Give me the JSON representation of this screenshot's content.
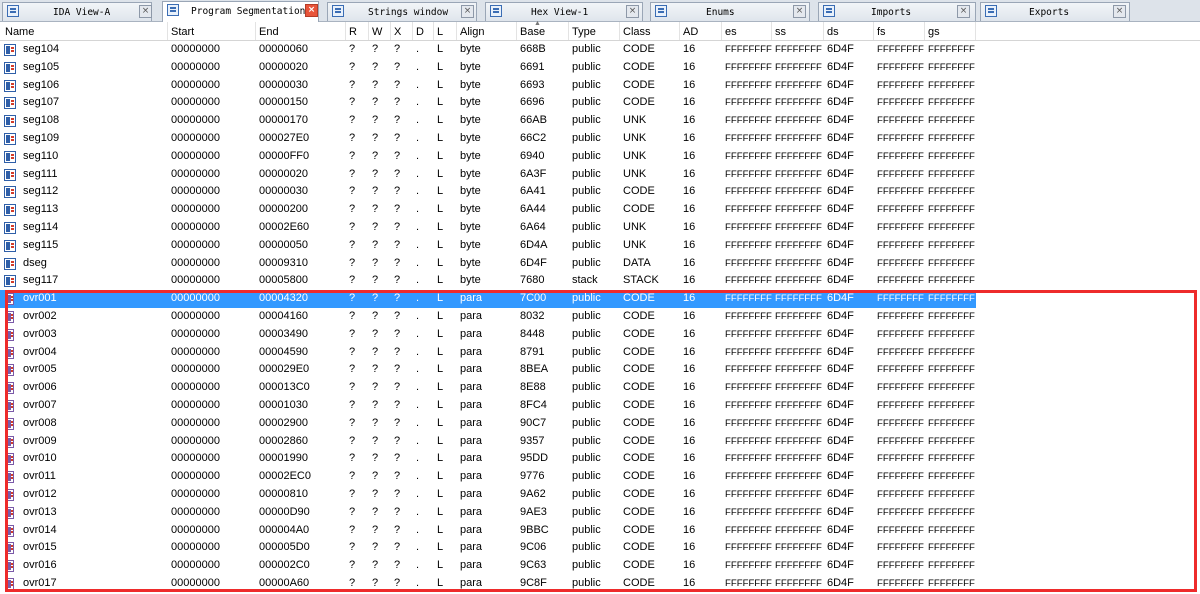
{
  "tabs": [
    {
      "label": "IDA View-A",
      "active": false,
      "icon": "disassembly-icon"
    },
    {
      "label": "Program Segmentation",
      "active": true,
      "icon": "segments-icon"
    },
    {
      "label": "Strings window",
      "active": false,
      "icon": "strings-icon"
    },
    {
      "label": "Hex View-1",
      "active": false,
      "icon": "hex-icon"
    },
    {
      "label": "Enums",
      "active": false,
      "icon": "enums-icon"
    },
    {
      "label": "Imports",
      "active": false,
      "icon": "imports-icon"
    },
    {
      "label": "Exports",
      "active": false,
      "icon": "exports-icon"
    }
  ],
  "columns": [
    "Name",
    "Start",
    "End",
    "R",
    "W",
    "X",
    "D",
    "L",
    "Align",
    "Base",
    "Type",
    "Class",
    "AD",
    "es",
    "ss",
    "ds",
    "fs",
    "gs"
  ],
  "sorted_column": "Base",
  "rows": [
    [
      "seg104",
      "00000000",
      "00000060",
      "?",
      "?",
      "?",
      ".",
      "L",
      "byte",
      "668B",
      "public",
      "CODE",
      "16",
      "FFFFFFFF",
      "FFFFFFFF",
      "6D4F",
      "FFFFFFFF",
      "FFFFFFFF"
    ],
    [
      "seg105",
      "00000000",
      "00000020",
      "?",
      "?",
      "?",
      ".",
      "L",
      "byte",
      "6691",
      "public",
      "CODE",
      "16",
      "FFFFFFFF",
      "FFFFFFFF",
      "6D4F",
      "FFFFFFFF",
      "FFFFFFFF"
    ],
    [
      "seg106",
      "00000000",
      "00000030",
      "?",
      "?",
      "?",
      ".",
      "L",
      "byte",
      "6693",
      "public",
      "CODE",
      "16",
      "FFFFFFFF",
      "FFFFFFFF",
      "6D4F",
      "FFFFFFFF",
      "FFFFFFFF"
    ],
    [
      "seg107",
      "00000000",
      "00000150",
      "?",
      "?",
      "?",
      ".",
      "L",
      "byte",
      "6696",
      "public",
      "CODE",
      "16",
      "FFFFFFFF",
      "FFFFFFFF",
      "6D4F",
      "FFFFFFFF",
      "FFFFFFFF"
    ],
    [
      "seg108",
      "00000000",
      "00000170",
      "?",
      "?",
      "?",
      ".",
      "L",
      "byte",
      "66AB",
      "public",
      "UNK",
      "16",
      "FFFFFFFF",
      "FFFFFFFF",
      "6D4F",
      "FFFFFFFF",
      "FFFFFFFF"
    ],
    [
      "seg109",
      "00000000",
      "000027E0",
      "?",
      "?",
      "?",
      ".",
      "L",
      "byte",
      "66C2",
      "public",
      "UNK",
      "16",
      "FFFFFFFF",
      "FFFFFFFF",
      "6D4F",
      "FFFFFFFF",
      "FFFFFFFF"
    ],
    [
      "seg110",
      "00000000",
      "00000FF0",
      "?",
      "?",
      "?",
      ".",
      "L",
      "byte",
      "6940",
      "public",
      "UNK",
      "16",
      "FFFFFFFF",
      "FFFFFFFF",
      "6D4F",
      "FFFFFFFF",
      "FFFFFFFF"
    ],
    [
      "seg111",
      "00000000",
      "00000020",
      "?",
      "?",
      "?",
      ".",
      "L",
      "byte",
      "6A3F",
      "public",
      "UNK",
      "16",
      "FFFFFFFF",
      "FFFFFFFF",
      "6D4F",
      "FFFFFFFF",
      "FFFFFFFF"
    ],
    [
      "seg112",
      "00000000",
      "00000030",
      "?",
      "?",
      "?",
      ".",
      "L",
      "byte",
      "6A41",
      "public",
      "CODE",
      "16",
      "FFFFFFFF",
      "FFFFFFFF",
      "6D4F",
      "FFFFFFFF",
      "FFFFFFFF"
    ],
    [
      "seg113",
      "00000000",
      "00000200",
      "?",
      "?",
      "?",
      ".",
      "L",
      "byte",
      "6A44",
      "public",
      "CODE",
      "16",
      "FFFFFFFF",
      "FFFFFFFF",
      "6D4F",
      "FFFFFFFF",
      "FFFFFFFF"
    ],
    [
      "seg114",
      "00000000",
      "00002E60",
      "?",
      "?",
      "?",
      ".",
      "L",
      "byte",
      "6A64",
      "public",
      "UNK",
      "16",
      "FFFFFFFF",
      "FFFFFFFF",
      "6D4F",
      "FFFFFFFF",
      "FFFFFFFF"
    ],
    [
      "seg115",
      "00000000",
      "00000050",
      "?",
      "?",
      "?",
      ".",
      "L",
      "byte",
      "6D4A",
      "public",
      "UNK",
      "16",
      "FFFFFFFF",
      "FFFFFFFF",
      "6D4F",
      "FFFFFFFF",
      "FFFFFFFF"
    ],
    [
      "dseg",
      "00000000",
      "00009310",
      "?",
      "?",
      "?",
      ".",
      "L",
      "byte",
      "6D4F",
      "public",
      "DATA",
      "16",
      "FFFFFFFF",
      "FFFFFFFF",
      "6D4F",
      "FFFFFFFF",
      "FFFFFFFF"
    ],
    [
      "seg117",
      "00000000",
      "00005800",
      "?",
      "?",
      "?",
      ".",
      "L",
      "byte",
      "7680",
      "stack",
      "STACK",
      "16",
      "FFFFFFFF",
      "FFFFFFFF",
      "6D4F",
      "FFFFFFFF",
      "FFFFFFFF"
    ],
    [
      "ovr001",
      "00000000",
      "00004320",
      "?",
      "?",
      "?",
      ".",
      "L",
      "para",
      "7C00",
      "public",
      "CODE",
      "16",
      "FFFFFFFF",
      "FFFFFFFF",
      "6D4F",
      "FFFFFFFF",
      "FFFFFFFF"
    ],
    [
      "ovr002",
      "00000000",
      "00004160",
      "?",
      "?",
      "?",
      ".",
      "L",
      "para",
      "8032",
      "public",
      "CODE",
      "16",
      "FFFFFFFF",
      "FFFFFFFF",
      "6D4F",
      "FFFFFFFF",
      "FFFFFFFF"
    ],
    [
      "ovr003",
      "00000000",
      "00003490",
      "?",
      "?",
      "?",
      ".",
      "L",
      "para",
      "8448",
      "public",
      "CODE",
      "16",
      "FFFFFFFF",
      "FFFFFFFF",
      "6D4F",
      "FFFFFFFF",
      "FFFFFFFF"
    ],
    [
      "ovr004",
      "00000000",
      "00004590",
      "?",
      "?",
      "?",
      ".",
      "L",
      "para",
      "8791",
      "public",
      "CODE",
      "16",
      "FFFFFFFF",
      "FFFFFFFF",
      "6D4F",
      "FFFFFFFF",
      "FFFFFFFF"
    ],
    [
      "ovr005",
      "00000000",
      "000029E0",
      "?",
      "?",
      "?",
      ".",
      "L",
      "para",
      "8BEA",
      "public",
      "CODE",
      "16",
      "FFFFFFFF",
      "FFFFFFFF",
      "6D4F",
      "FFFFFFFF",
      "FFFFFFFF"
    ],
    [
      "ovr006",
      "00000000",
      "000013C0",
      "?",
      "?",
      "?",
      ".",
      "L",
      "para",
      "8E88",
      "public",
      "CODE",
      "16",
      "FFFFFFFF",
      "FFFFFFFF",
      "6D4F",
      "FFFFFFFF",
      "FFFFFFFF"
    ],
    [
      "ovr007",
      "00000000",
      "00001030",
      "?",
      "?",
      "?",
      ".",
      "L",
      "para",
      "8FC4",
      "public",
      "CODE",
      "16",
      "FFFFFFFF",
      "FFFFFFFF",
      "6D4F",
      "FFFFFFFF",
      "FFFFFFFF"
    ],
    [
      "ovr008",
      "00000000",
      "00002900",
      "?",
      "?",
      "?",
      ".",
      "L",
      "para",
      "90C7",
      "public",
      "CODE",
      "16",
      "FFFFFFFF",
      "FFFFFFFF",
      "6D4F",
      "FFFFFFFF",
      "FFFFFFFF"
    ],
    [
      "ovr009",
      "00000000",
      "00002860",
      "?",
      "?",
      "?",
      ".",
      "L",
      "para",
      "9357",
      "public",
      "CODE",
      "16",
      "FFFFFFFF",
      "FFFFFFFF",
      "6D4F",
      "FFFFFFFF",
      "FFFFFFFF"
    ],
    [
      "ovr010",
      "00000000",
      "00001990",
      "?",
      "?",
      "?",
      ".",
      "L",
      "para",
      "95DD",
      "public",
      "CODE",
      "16",
      "FFFFFFFF",
      "FFFFFFFF",
      "6D4F",
      "FFFFFFFF",
      "FFFFFFFF"
    ],
    [
      "ovr011",
      "00000000",
      "00002EC0",
      "?",
      "?",
      "?",
      ".",
      "L",
      "para",
      "9776",
      "public",
      "CODE",
      "16",
      "FFFFFFFF",
      "FFFFFFFF",
      "6D4F",
      "FFFFFFFF",
      "FFFFFFFF"
    ],
    [
      "ovr012",
      "00000000",
      "00000810",
      "?",
      "?",
      "?",
      ".",
      "L",
      "para",
      "9A62",
      "public",
      "CODE",
      "16",
      "FFFFFFFF",
      "FFFFFFFF",
      "6D4F",
      "FFFFFFFF",
      "FFFFFFFF"
    ],
    [
      "ovr013",
      "00000000",
      "00000D90",
      "?",
      "?",
      "?",
      ".",
      "L",
      "para",
      "9AE3",
      "public",
      "CODE",
      "16",
      "FFFFFFFF",
      "FFFFFFFF",
      "6D4F",
      "FFFFFFFF",
      "FFFFFFFF"
    ],
    [
      "ovr014",
      "00000000",
      "000004A0",
      "?",
      "?",
      "?",
      ".",
      "L",
      "para",
      "9BBC",
      "public",
      "CODE",
      "16",
      "FFFFFFFF",
      "FFFFFFFF",
      "6D4F",
      "FFFFFFFF",
      "FFFFFFFF"
    ],
    [
      "ovr015",
      "00000000",
      "000005D0",
      "?",
      "?",
      "?",
      ".",
      "L",
      "para",
      "9C06",
      "public",
      "CODE",
      "16",
      "FFFFFFFF",
      "FFFFFFFF",
      "6D4F",
      "FFFFFFFF",
      "FFFFFFFF"
    ],
    [
      "ovr016",
      "00000000",
      "000002C0",
      "?",
      "?",
      "?",
      ".",
      "L",
      "para",
      "9C63",
      "public",
      "CODE",
      "16",
      "FFFFFFFF",
      "FFFFFFFF",
      "6D4F",
      "FFFFFFFF",
      "FFFFFFFF"
    ],
    [
      "ovr017",
      "00000000",
      "00000A60",
      "?",
      "?",
      "?",
      ".",
      "L",
      "para",
      "9C8F",
      "public",
      "CODE",
      "16",
      "FFFFFFFF",
      "FFFFFFFF",
      "6D4F",
      "FFFFFFFF",
      "FFFFFFFF"
    ]
  ],
  "selected_row": 14,
  "colors": {
    "selection": "#3399ff",
    "highlight_box": "#ee2b2b",
    "tab_bar": "#dde3ea"
  }
}
